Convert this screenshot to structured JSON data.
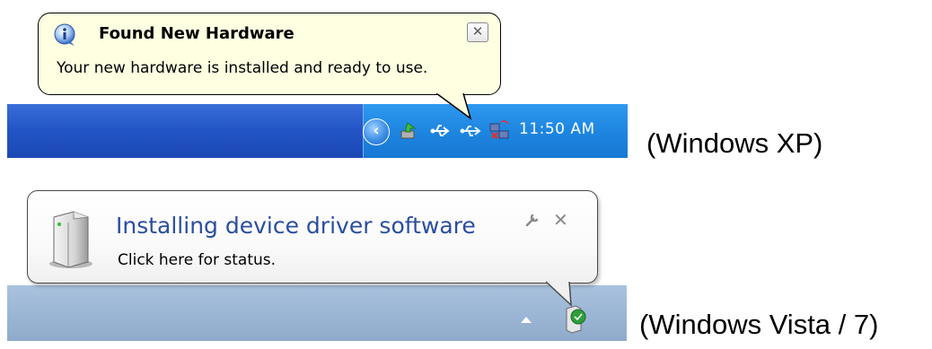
{
  "xp": {
    "balloon_title": "Found New Hardware",
    "balloon_message": "Your new hardware is installed and ready to use.",
    "close_glyph": "✕",
    "clock": "11:50 AM",
    "caption": "(Windows XP)",
    "icons": [
      "info-icon",
      "show-hidden-icons-chevron",
      "safely-remove-icon",
      "usb-icon",
      "network-icon",
      "wireless-icon"
    ]
  },
  "vista": {
    "balloon_title": "Installing device driver software",
    "balloon_message": "Click here for status.",
    "close_glyph": "✕",
    "wrench_glyph": "🔧",
    "caption": "(Windows Vista / 7)",
    "icons": [
      "device-driver-icon",
      "wrench-icon",
      "show-hidden-icons-arrow",
      "device-install-tray-icon"
    ]
  },
  "colors": {
    "xp_taskbar": "#2456c8",
    "xp_tray": "#1e86e0",
    "xp_balloon_bg": "#ffffe1",
    "vista_taskbar": "#9cb6d5",
    "vista_title": "#2a4ea0"
  }
}
